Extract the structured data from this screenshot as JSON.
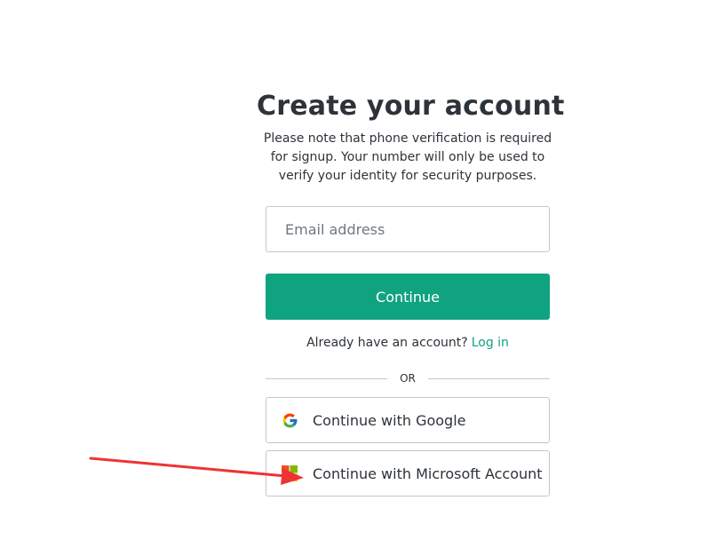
{
  "signup": {
    "title": "Create your account",
    "subtitle": "Please note that phone verification is required for signup. Your number will only be used to verify your identity for security purposes.",
    "email_placeholder": "Email address",
    "email_value": "",
    "continue_label": "Continue",
    "login_prompt": "Already have an account?",
    "login_link": "Log in",
    "divider_text": "OR",
    "google_label": "Continue with Google",
    "microsoft_label": "Continue with Microsoft Account"
  },
  "icons": {
    "google": "google-logo-icon",
    "microsoft": "microsoft-logo-icon"
  },
  "colors": {
    "accent": "#10a37f",
    "text": "#2d333a",
    "border": "#c2c8d0",
    "annotation_arrow": "#ee3333"
  }
}
